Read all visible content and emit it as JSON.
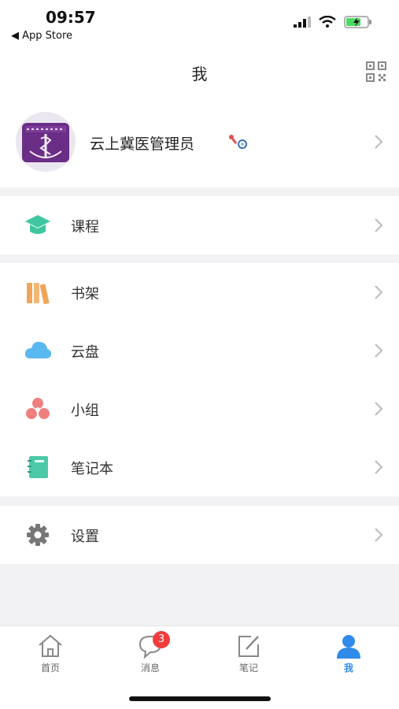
{
  "status_bar": {
    "time": "09:57",
    "back_label": "App Store"
  },
  "nav": {
    "title": "我"
  },
  "profile": {
    "name": "云上冀医管理员"
  },
  "menu_groups": [
    [
      {
        "label": "课程",
        "icon": "graduation-cap-icon",
        "color": "#3fc6a0"
      }
    ],
    [
      {
        "label": "书架",
        "icon": "bookshelf-icon",
        "color": "#f0a55a"
      },
      {
        "label": "云盘",
        "icon": "cloud-icon",
        "color": "#5ab8f0"
      },
      {
        "label": "小组",
        "icon": "group-icon",
        "color": "#f08080"
      },
      {
        "label": "笔记本",
        "icon": "notebook-icon",
        "color": "#4cc9a8"
      }
    ],
    [
      {
        "label": "设置",
        "icon": "gear-icon",
        "color": "#777777"
      }
    ]
  ],
  "tabbar": {
    "tabs": [
      {
        "label": "首页",
        "icon": "home-icon"
      },
      {
        "label": "消息",
        "icon": "message-icon",
        "badge": "3"
      },
      {
        "label": "笔记",
        "icon": "note-edit-icon"
      },
      {
        "label": "我",
        "icon": "profile-icon",
        "active": true
      }
    ]
  },
  "colors": {
    "accent": "#2f8bea",
    "badge": "#f23c3c"
  }
}
